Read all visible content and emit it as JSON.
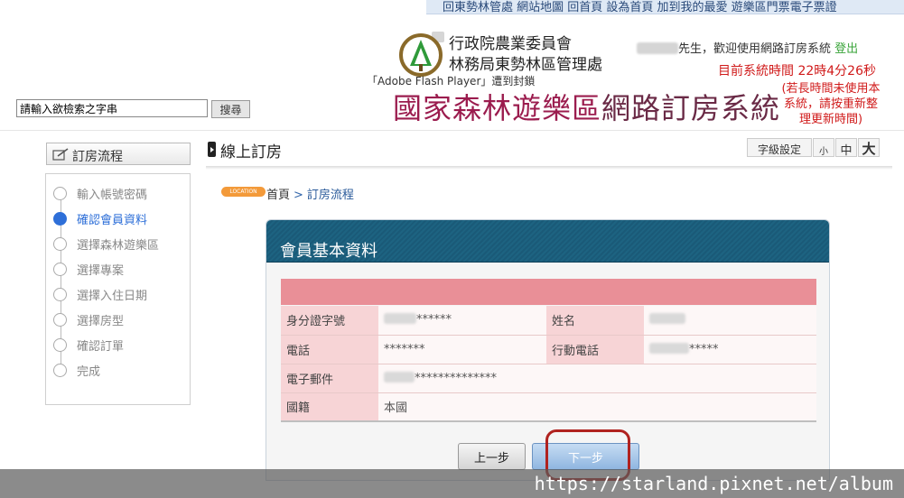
{
  "header": {
    "top_links": "回東勢林管處 網站地圖 回首頁 設為首頁 加到我的最愛 遊樂區門票電子票證",
    "agency_line1": "行政院農業委員會",
    "agency_line2": "林務局東勢林區管理處",
    "flash_notice": "「Adobe Flash Player」遭到封鎖",
    "welcome_text": "先生，歡迎使用網路訂房系統",
    "logout_label": "登出",
    "sys_time": "目前系統時間 22時4分26秒",
    "idle_notice": "(若長時間未使用本系統，請按重新整理更新時間)",
    "title_part1": "國家森林遊樂區",
    "title_part2": "網路訂房系統"
  },
  "search": {
    "placeholder": "請輸入欲檢索之字串",
    "value": "請輸入欲檢索之字串",
    "button_label": "搜尋"
  },
  "sidebar": {
    "heading": "訂房流程",
    "steps": [
      {
        "label": "輸入帳號密碼",
        "active": false
      },
      {
        "label": "確認會員資料",
        "active": true
      },
      {
        "label": "選擇森林遊樂區",
        "active": false
      },
      {
        "label": "選擇專案",
        "active": false
      },
      {
        "label": "選擇入住日期",
        "active": false
      },
      {
        "label": "選擇房型",
        "active": false
      },
      {
        "label": "確認訂單",
        "active": false
      },
      {
        "label": "完成",
        "active": false
      }
    ]
  },
  "content": {
    "page_title": "線上訂房",
    "font_size_label": "字級設定",
    "font_small": "小",
    "font_medium": "中",
    "font_large": "大",
    "location_badge": "LOCATION",
    "breadcrumb_home": "首頁",
    "breadcrumb_sep": ">",
    "breadcrumb_current": "訂房流程"
  },
  "panel": {
    "title": "會員基本資料",
    "labels": {
      "id_number": "身分證字號",
      "name": "姓名",
      "phone": "電話",
      "mobile": "行動電話",
      "email": "電子郵件",
      "nationality": "國籍"
    },
    "values": {
      "id_number": "******",
      "name": "",
      "phone": "*******",
      "mobile": "*****",
      "email": "**************",
      "nationality": "本國"
    },
    "prev_label": "上一步",
    "next_label": "下一步"
  },
  "colors": {
    "panel_header": "#1d6381",
    "row_bar": "#e98f97",
    "label_cell": "#f7d4d6",
    "title_red": "#8a1f4f",
    "time_red": "#d01a1a",
    "active_step": "#2e6fd8",
    "highlight": "#b0221f"
  },
  "watermark": "https://starland.pixnet.net/album"
}
